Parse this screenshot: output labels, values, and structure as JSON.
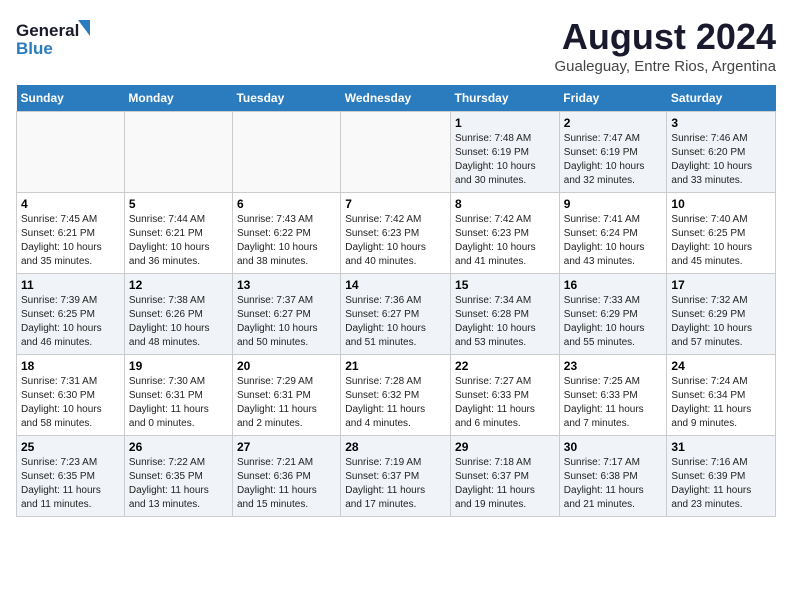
{
  "logo": {
    "line1": "General",
    "line2": "Blue"
  },
  "title": "August 2024",
  "subtitle": "Gualeguay, Entre Rios, Argentina",
  "days_of_week": [
    "Sunday",
    "Monday",
    "Tuesday",
    "Wednesday",
    "Thursday",
    "Friday",
    "Saturday"
  ],
  "weeks": [
    [
      {
        "day": "",
        "info": ""
      },
      {
        "day": "",
        "info": ""
      },
      {
        "day": "",
        "info": ""
      },
      {
        "day": "",
        "info": ""
      },
      {
        "day": "1",
        "info": "Sunrise: 7:48 AM\nSunset: 6:19 PM\nDaylight: 10 hours\nand 30 minutes."
      },
      {
        "day": "2",
        "info": "Sunrise: 7:47 AM\nSunset: 6:19 PM\nDaylight: 10 hours\nand 32 minutes."
      },
      {
        "day": "3",
        "info": "Sunrise: 7:46 AM\nSunset: 6:20 PM\nDaylight: 10 hours\nand 33 minutes."
      }
    ],
    [
      {
        "day": "4",
        "info": "Sunrise: 7:45 AM\nSunset: 6:21 PM\nDaylight: 10 hours\nand 35 minutes."
      },
      {
        "day": "5",
        "info": "Sunrise: 7:44 AM\nSunset: 6:21 PM\nDaylight: 10 hours\nand 36 minutes."
      },
      {
        "day": "6",
        "info": "Sunrise: 7:43 AM\nSunset: 6:22 PM\nDaylight: 10 hours\nand 38 minutes."
      },
      {
        "day": "7",
        "info": "Sunrise: 7:42 AM\nSunset: 6:23 PM\nDaylight: 10 hours\nand 40 minutes."
      },
      {
        "day": "8",
        "info": "Sunrise: 7:42 AM\nSunset: 6:23 PM\nDaylight: 10 hours\nand 41 minutes."
      },
      {
        "day": "9",
        "info": "Sunrise: 7:41 AM\nSunset: 6:24 PM\nDaylight: 10 hours\nand 43 minutes."
      },
      {
        "day": "10",
        "info": "Sunrise: 7:40 AM\nSunset: 6:25 PM\nDaylight: 10 hours\nand 45 minutes."
      }
    ],
    [
      {
        "day": "11",
        "info": "Sunrise: 7:39 AM\nSunset: 6:25 PM\nDaylight: 10 hours\nand 46 minutes."
      },
      {
        "day": "12",
        "info": "Sunrise: 7:38 AM\nSunset: 6:26 PM\nDaylight: 10 hours\nand 48 minutes."
      },
      {
        "day": "13",
        "info": "Sunrise: 7:37 AM\nSunset: 6:27 PM\nDaylight: 10 hours\nand 50 minutes."
      },
      {
        "day": "14",
        "info": "Sunrise: 7:36 AM\nSunset: 6:27 PM\nDaylight: 10 hours\nand 51 minutes."
      },
      {
        "day": "15",
        "info": "Sunrise: 7:34 AM\nSunset: 6:28 PM\nDaylight: 10 hours\nand 53 minutes."
      },
      {
        "day": "16",
        "info": "Sunrise: 7:33 AM\nSunset: 6:29 PM\nDaylight: 10 hours\nand 55 minutes."
      },
      {
        "day": "17",
        "info": "Sunrise: 7:32 AM\nSunset: 6:29 PM\nDaylight: 10 hours\nand 57 minutes."
      }
    ],
    [
      {
        "day": "18",
        "info": "Sunrise: 7:31 AM\nSunset: 6:30 PM\nDaylight: 10 hours\nand 58 minutes."
      },
      {
        "day": "19",
        "info": "Sunrise: 7:30 AM\nSunset: 6:31 PM\nDaylight: 11 hours\nand 0 minutes."
      },
      {
        "day": "20",
        "info": "Sunrise: 7:29 AM\nSunset: 6:31 PM\nDaylight: 11 hours\nand 2 minutes."
      },
      {
        "day": "21",
        "info": "Sunrise: 7:28 AM\nSunset: 6:32 PM\nDaylight: 11 hours\nand 4 minutes."
      },
      {
        "day": "22",
        "info": "Sunrise: 7:27 AM\nSunset: 6:33 PM\nDaylight: 11 hours\nand 6 minutes."
      },
      {
        "day": "23",
        "info": "Sunrise: 7:25 AM\nSunset: 6:33 PM\nDaylight: 11 hours\nand 7 minutes."
      },
      {
        "day": "24",
        "info": "Sunrise: 7:24 AM\nSunset: 6:34 PM\nDaylight: 11 hours\nand 9 minutes."
      }
    ],
    [
      {
        "day": "25",
        "info": "Sunrise: 7:23 AM\nSunset: 6:35 PM\nDaylight: 11 hours\nand 11 minutes."
      },
      {
        "day": "26",
        "info": "Sunrise: 7:22 AM\nSunset: 6:35 PM\nDaylight: 11 hours\nand 13 minutes."
      },
      {
        "day": "27",
        "info": "Sunrise: 7:21 AM\nSunset: 6:36 PM\nDaylight: 11 hours\nand 15 minutes."
      },
      {
        "day": "28",
        "info": "Sunrise: 7:19 AM\nSunset: 6:37 PM\nDaylight: 11 hours\nand 17 minutes."
      },
      {
        "day": "29",
        "info": "Sunrise: 7:18 AM\nSunset: 6:37 PM\nDaylight: 11 hours\nand 19 minutes."
      },
      {
        "day": "30",
        "info": "Sunrise: 7:17 AM\nSunset: 6:38 PM\nDaylight: 11 hours\nand 21 minutes."
      },
      {
        "day": "31",
        "info": "Sunrise: 7:16 AM\nSunset: 6:39 PM\nDaylight: 11 hours\nand 23 minutes."
      }
    ]
  ]
}
